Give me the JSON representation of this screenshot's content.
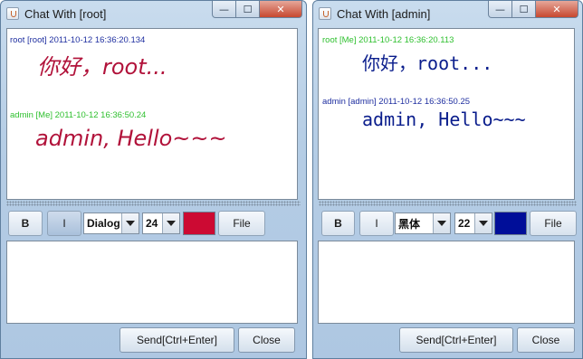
{
  "windows": [
    {
      "title": "Chat With [root]",
      "messages": [
        {
          "meta": "root [root] 2011-10-12 16:36:20.134",
          "text": "你好，root..."
        },
        {
          "meta": "admin   [Me]     2011-10-12 16:36:50.24",
          "text": "admin, Hello~~~"
        }
      ],
      "toolbar": {
        "bold": "B",
        "italic": "I",
        "font": "Dialog",
        "size": "24",
        "color": "#cc0a33",
        "file": "File"
      },
      "send": "Send[Ctrl+Enter]",
      "close": "Close"
    },
    {
      "title": "Chat With [admin]",
      "messages": [
        {
          "meta": "root   [Me]     2011-10-12 16:36:20.113",
          "text": "你好，root..."
        },
        {
          "meta": "admin [admin] 2011-10-12 16:36:50.25",
          "text": "admin, Hello~~~"
        }
      ],
      "toolbar": {
        "bold": "B",
        "italic": "I",
        "font": "黑体",
        "size": "22",
        "color": "#000e99",
        "file": "File"
      },
      "send": "Send[Ctrl+Enter]",
      "close": "Close"
    }
  ],
  "window_controls": {
    "minimize": "—",
    "maximize": "☐",
    "close": "✕"
  }
}
